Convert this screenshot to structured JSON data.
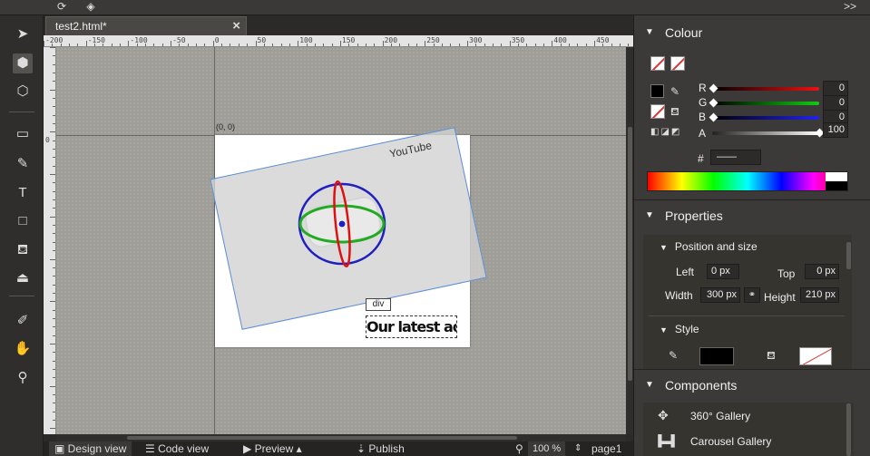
{
  "app": {
    "title_icon_1": "refresh-icon",
    "title_icon_2": "cube-icon",
    "expand_label": ">>"
  },
  "tab": {
    "title": "test2.html*",
    "close": "×"
  },
  "hruler": {
    "ticks": [
      "-200",
      "-150",
      "-100",
      "-50",
      "0",
      "50",
      "100",
      "150",
      "200",
      "250",
      "300",
      "350",
      "400",
      "450"
    ]
  },
  "vruler": {
    "ticks": [
      "0"
    ]
  },
  "stage": {
    "origin_label": "(0, 0)",
    "youtube_text": "YouTube",
    "div_label": "div",
    "ad_text": "Our latest ad!"
  },
  "status": {
    "design_view": "Design view",
    "code_view": "Code view",
    "preview": "Preview",
    "publish": "Publish",
    "zoom": "100 %",
    "page": "page1"
  },
  "colour": {
    "title": "Colour",
    "r_label": "R",
    "g_label": "G",
    "b_label": "B",
    "a_label": "A",
    "r_value": "0",
    "g_value": "0",
    "b_value": "0",
    "a_value": "100",
    "hash_label": "#",
    "hex_value": "——"
  },
  "properties": {
    "title": "Properties",
    "position_title": "Position and size",
    "left_label": "Left",
    "left_value": "0 px",
    "top_label": "Top",
    "top_value": "0 px",
    "width_label": "Width",
    "width_value": "300 px",
    "height_label": "Height",
    "height_value": "210 px",
    "style_title": "Style"
  },
  "components": {
    "title": "Components",
    "items": [
      "360° Gallery",
      "Carousel Gallery"
    ]
  },
  "colors": {
    "r": "#d11",
    "g": "#1a1",
    "b": "#22c",
    "selection": "#5b8fd6"
  }
}
